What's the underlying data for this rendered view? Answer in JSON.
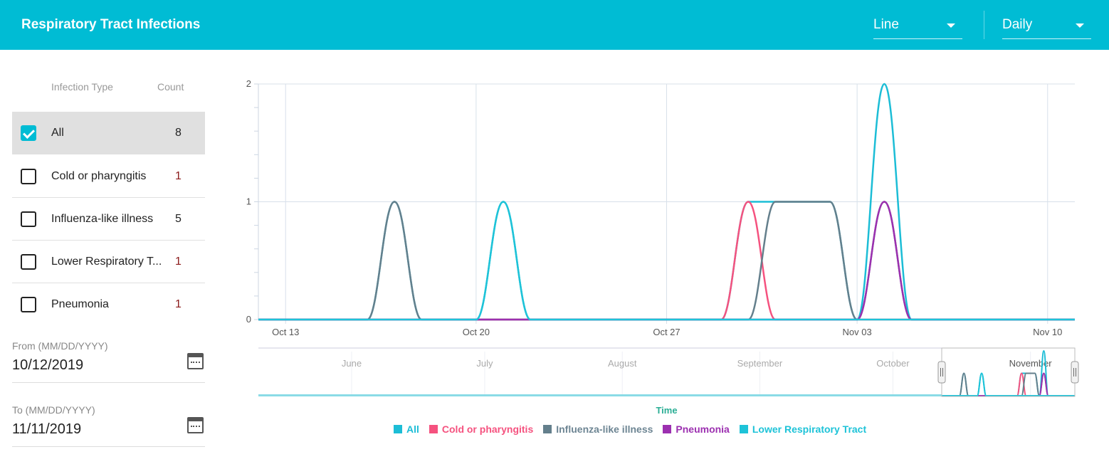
{
  "header": {
    "title": "Respiratory Tract Infections",
    "chart_type": "Line",
    "interval": "Daily",
    "bg": "#00bcd4"
  },
  "table": {
    "col_type": "Infection Type",
    "col_count": "Count",
    "rows": [
      {
        "label": "All",
        "count": "8",
        "checked": true
      },
      {
        "label": "Cold or pharyngitis",
        "count": "1",
        "checked": false
      },
      {
        "label": "Influenza-like illness",
        "count": "5",
        "checked": false
      },
      {
        "label": "Lower Respiratory T...",
        "count": "1",
        "checked": false
      },
      {
        "label": "Pneumonia",
        "count": "1",
        "checked": false
      }
    ]
  },
  "from": {
    "label": "From (MM/DD/YYYY)",
    "value": "10/12/2019",
    "icon": "calendar-icon"
  },
  "to": {
    "label": "To (MM/DD/YYYY)",
    "value": "11/11/2019",
    "icon": "calendar-icon"
  },
  "chart_data": {
    "type": "line",
    "xlabel": "Time",
    "ylabel": "",
    "ylim": [
      0,
      2
    ],
    "grid": true,
    "legend": "bottom",
    "yticks": [
      "0",
      "1",
      "2"
    ],
    "xticks": [
      "Oct 13",
      "Oct 20",
      "Oct 27",
      "Nov 03",
      "Nov 10"
    ],
    "navigator_months": [
      "June",
      "July",
      "August",
      "September",
      "October",
      "November"
    ],
    "x": [
      "2019-10-12",
      "2019-10-13",
      "2019-10-14",
      "2019-10-15",
      "2019-10-16",
      "2019-10-17",
      "2019-10-18",
      "2019-10-19",
      "2019-10-20",
      "2019-10-21",
      "2019-10-22",
      "2019-10-23",
      "2019-10-24",
      "2019-10-25",
      "2019-10-26",
      "2019-10-27",
      "2019-10-28",
      "2019-10-29",
      "2019-10-30",
      "2019-10-31",
      "2019-11-01",
      "2019-11-02",
      "2019-11-03",
      "2019-11-04",
      "2019-11-05",
      "2019-11-06",
      "2019-11-07",
      "2019-11-08",
      "2019-11-09",
      "2019-11-10",
      "2019-11-11"
    ],
    "series": [
      {
        "name": "All",
        "color": "#1cbdd6",
        "values": [
          0,
          0,
          0,
          0,
          0,
          1,
          0,
          0,
          0,
          1,
          0,
          0,
          0,
          0,
          0,
          0,
          0,
          0,
          1,
          1,
          1,
          1,
          0,
          2,
          0,
          0,
          0,
          0,
          0,
          0,
          0
        ]
      },
      {
        "name": "Cold or pharyngitis",
        "color": "#f5527f",
        "values": [
          0,
          0,
          0,
          0,
          0,
          0,
          0,
          0,
          0,
          0,
          0,
          0,
          0,
          0,
          0,
          0,
          0,
          0,
          1,
          0,
          0,
          0,
          0,
          0,
          0,
          0,
          0,
          0,
          0,
          0,
          0
        ]
      },
      {
        "name": "Influenza-like illness",
        "color": "#647f8c",
        "values": [
          0,
          0,
          0,
          0,
          0,
          1,
          0,
          0,
          0,
          0,
          0,
          0,
          0,
          0,
          0,
          0,
          0,
          0,
          0,
          1,
          1,
          1,
          0,
          1,
          0,
          0,
          0,
          0,
          0,
          0,
          0
        ]
      },
      {
        "name": "Pneumonia",
        "color": "#9c30b0",
        "values": [
          0,
          0,
          0,
          0,
          0,
          0,
          0,
          0,
          0,
          0,
          0,
          0,
          0,
          0,
          0,
          0,
          0,
          0,
          0,
          0,
          0,
          0,
          0,
          1,
          0,
          0,
          0,
          0,
          0,
          0,
          0
        ]
      },
      {
        "name": "Lower Respiratory Tract",
        "color": "#1ec3d8",
        "values": [
          0,
          0,
          0,
          0,
          0,
          0,
          0,
          0,
          0,
          1,
          0,
          0,
          0,
          0,
          0,
          0,
          0,
          0,
          0,
          0,
          0,
          0,
          0,
          0,
          0,
          0,
          0,
          0,
          0,
          0,
          0
        ]
      }
    ],
    "xlabel_color": "#2bae95"
  }
}
